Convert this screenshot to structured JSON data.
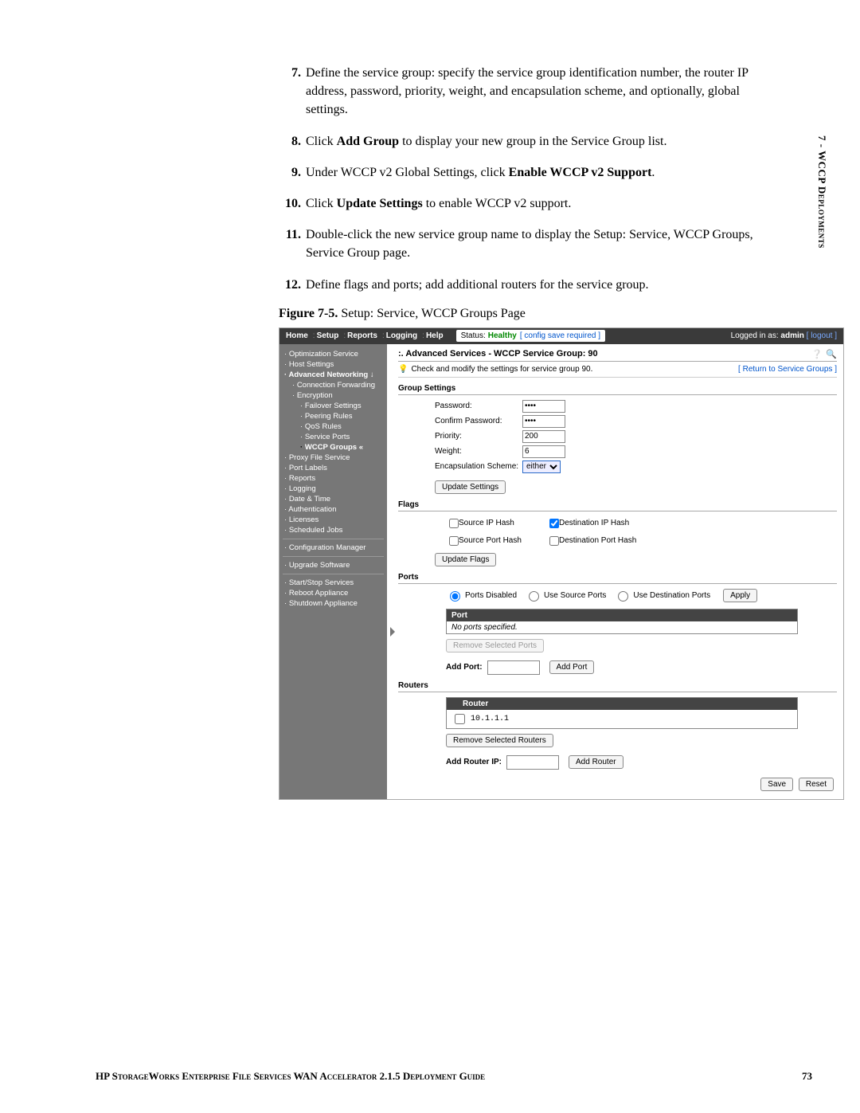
{
  "side_tab": "7 - WCCP Deployments",
  "steps": [
    {
      "n": "7.",
      "t": "Define the service group: specify the service group identification number, the router IP address, password, priority, weight, and encapsulation scheme, and optionally, global settings."
    },
    {
      "n": "8.",
      "t_pre": "Click ",
      "b1": "Add Group",
      "t_post": " to display your new group in the Service Group list."
    },
    {
      "n": "9.",
      "t_pre": "Under WCCP v2 Global Settings, click ",
      "b1": "Enable WCCP v2 Support",
      "t_post": "."
    },
    {
      "n": "10.",
      "t_pre": "Click ",
      "b1": "Update Settings",
      "t_post": " to enable WCCP v2 support."
    },
    {
      "n": "11.",
      "t": "Double-click the new service group name to display the Setup: Service, WCCP Groups, Service Group page."
    },
    {
      "n": "12.",
      "t": "Define flags and ports; add additional routers for the service group."
    }
  ],
  "figure": {
    "label": "Figure 7-5.",
    "caption": " Setup: Service, WCCP Groups Page"
  },
  "shot": {
    "nav": [
      "Home",
      "Setup",
      "Reports",
      "Logging",
      "Help"
    ],
    "status": {
      "k": "Status:",
      "v": "Healthy",
      "cfg": "[ config save required ]"
    },
    "login": {
      "pre": "Logged in as: ",
      "user": "admin",
      "logout": "[ logout ]"
    },
    "sidebar": [
      {
        "t": "Optimization Service",
        "lvl": 1,
        "b": true
      },
      {
        "t": "Host Settings",
        "lvl": 1,
        "b": true
      },
      {
        "t": "Advanced Networking ↓",
        "lvl": 1,
        "b": true,
        "bold": true
      },
      {
        "t": "Connection Forwarding",
        "lvl": 2,
        "b": true
      },
      {
        "t": "Encryption",
        "lvl": 2,
        "b": true
      },
      {
        "t": "Failover Settings",
        "lvl": 3,
        "b": true
      },
      {
        "t": "Peering Rules",
        "lvl": 3,
        "b": true
      },
      {
        "t": "QoS Rules",
        "lvl": 3,
        "b": true
      },
      {
        "t": "Service Ports",
        "lvl": 3,
        "b": true
      },
      {
        "t": "WCCP Groups «",
        "lvl": 3,
        "b": true,
        "boldblack": true
      },
      {
        "t": "Proxy File Service",
        "lvl": 1,
        "b": true
      },
      {
        "t": "Port Labels",
        "lvl": 1,
        "b": true
      },
      {
        "t": "Reports",
        "lvl": 1,
        "b": true
      },
      {
        "t": "Logging",
        "lvl": 1,
        "b": true
      },
      {
        "t": "Date & Time",
        "lvl": 1,
        "b": true
      },
      {
        "t": "Authentication",
        "lvl": 1,
        "b": true
      },
      {
        "t": "Licenses",
        "lvl": 1,
        "b": true
      },
      {
        "t": "Scheduled Jobs",
        "lvl": 1,
        "b": true
      },
      {
        "hr": true
      },
      {
        "t": "Configuration Manager",
        "lvl": 1,
        "b": true
      },
      {
        "hr": true
      },
      {
        "t": "Upgrade Software",
        "lvl": 1,
        "b": true
      },
      {
        "hr": true
      },
      {
        "t": "Start/Stop Services",
        "lvl": 1,
        "b": true
      },
      {
        "t": "Reboot Appliance",
        "lvl": 1,
        "b": true
      },
      {
        "t": "Shutdown Appliance",
        "lvl": 1,
        "b": true
      }
    ],
    "main": {
      "title": ":. Advanced Services - WCCP Service Group: 90",
      "help": "Check and modify the settings for service group 90.",
      "return_link": "[ Return to Service Groups ]",
      "group_settings": {
        "header": "Group Settings",
        "rows": {
          "password_l": "Password:",
          "password_v": "••••",
          "confirm_l": "Confirm Password:",
          "confirm_v": "••••",
          "priority_l": "Priority:",
          "priority_v": "200",
          "weight_l": "Weight:",
          "weight_v": "6",
          "encap_l": "Encapsulation Scheme:",
          "encap_v": "either"
        },
        "btn": "Update Settings"
      },
      "flags": {
        "header": "Flags",
        "items": {
          "src_ip": {
            "l": "Source IP Hash",
            "c": false
          },
          "dst_ip": {
            "l": "Destination IP Hash",
            "c": true
          },
          "src_port": {
            "l": "Source Port Hash",
            "c": false
          },
          "dst_port": {
            "l": "Destination Port Hash",
            "c": false
          }
        },
        "btn": "Update Flags"
      },
      "ports": {
        "header": "Ports",
        "radio": {
          "disabled": "Ports Disabled",
          "src": "Use Source Ports",
          "dst": "Use Destination Ports"
        },
        "apply": "Apply",
        "table_hdr": "Port",
        "empty": "No ports specified.",
        "remove_btn": "Remove Selected Ports",
        "add_l": "Add Port:",
        "add_btn": "Add Port"
      },
      "routers": {
        "header": "Routers",
        "table_hdr": "Router",
        "rows": [
          "10.1.1.1"
        ],
        "remove_btn": "Remove Selected Routers",
        "add_l": "Add Router IP:",
        "add_btn": "Add Router"
      },
      "save": "Save",
      "reset": "Reset"
    }
  },
  "footer": {
    "text": "HP StorageWorks Enterprise File Services WAN Accelerator 2.1.5 Deployment Guide",
    "page": "73"
  }
}
